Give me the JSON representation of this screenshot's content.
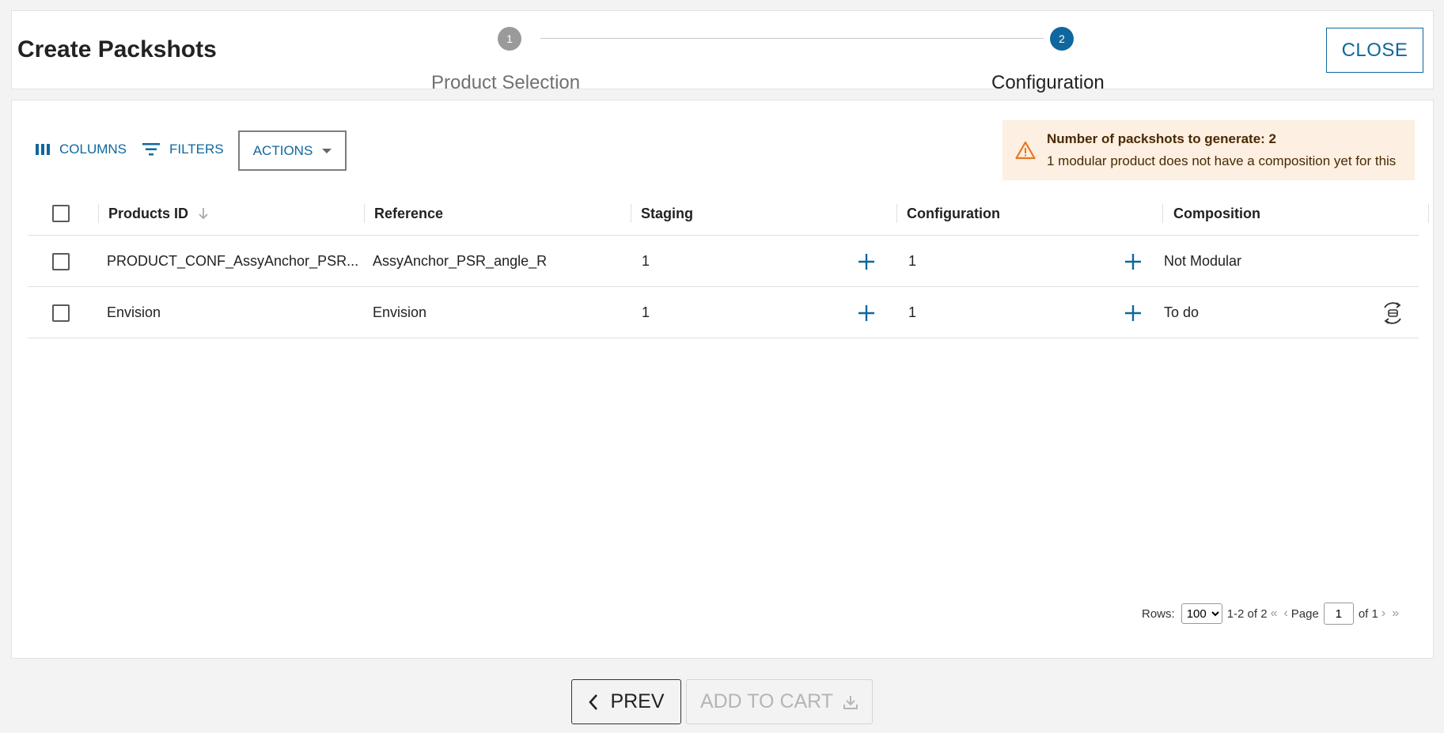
{
  "header": {
    "title": "Create Packshots",
    "close_label": "CLOSE",
    "steps": [
      {
        "number": "1",
        "label": "Product Selection",
        "state": "completed"
      },
      {
        "number": "2",
        "label": "Configuration",
        "state": "active"
      }
    ]
  },
  "toolbar": {
    "columns_label": "COLUMNS",
    "filters_label": "FILTERS",
    "actions_label": "ACTIONS"
  },
  "alert": {
    "title": "Number of packshots to generate: 2",
    "text": "1 modular product does not have a composition yet for this"
  },
  "table": {
    "columns": [
      "Products ID",
      "Reference",
      "Staging",
      "Configuration",
      "Composition"
    ],
    "rows": [
      {
        "product_id": "PRODUCT_CONF_AssyAnchor_PSR...",
        "reference": "AssyAnchor_PSR_angle_R",
        "staging": "1",
        "configuration": "1",
        "composition": "Not Modular"
      },
      {
        "product_id": "Envision",
        "reference": "Envision",
        "staging": "1",
        "configuration": "1",
        "composition": "To do"
      }
    ]
  },
  "pagination": {
    "rows_label": "Rows:",
    "rows_per_page": "100",
    "range": "1-2 of 2",
    "page_label": "Page",
    "page": "1",
    "of_label": "of 1"
  },
  "footer": {
    "prev_label": "PREV",
    "add_to_cart_label": "ADD TO CART"
  },
  "colors": {
    "accent": "#0f679d",
    "alert_bg": "#fdefe2",
    "alert_icon": "#e87722"
  },
  "icons": [
    "columns-icon",
    "filter-icon",
    "sort-arrow-down-icon",
    "plus-icon",
    "compose-3d-icon",
    "warning-icon",
    "chevron-left-icon",
    "download-icon"
  ]
}
